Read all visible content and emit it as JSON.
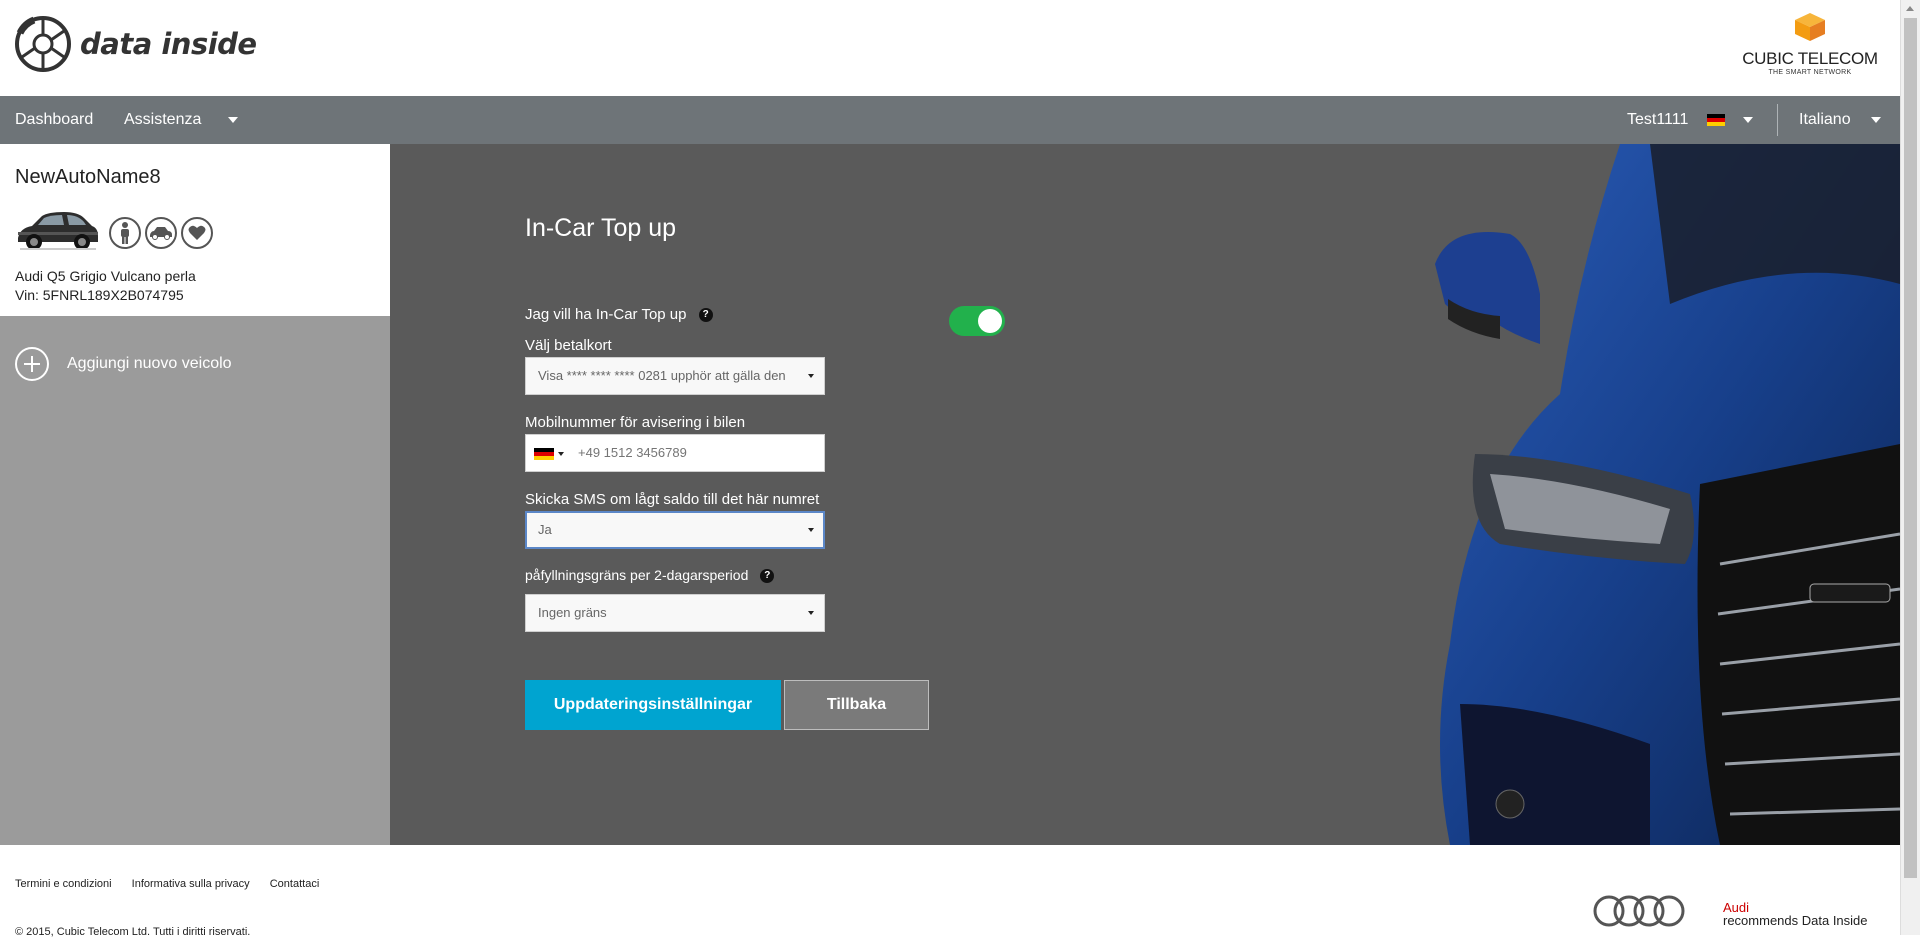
{
  "brand": {
    "logo_text": "data inside"
  },
  "partner": {
    "name": "CUBIC TELECOM",
    "tagline": "THE SMART NETWORK"
  },
  "nav": {
    "dashboard": "Dashboard",
    "assistance": "Assistenza",
    "user": "Test1111",
    "language": "Italiano"
  },
  "vehicle": {
    "name": "NewAutoName8",
    "model": "Audi Q5 Grigio Vulcano perla",
    "vin": "Vin: 5FNRL189X2B074795"
  },
  "sidebar": {
    "add_vehicle": "Aggiungi nuovo veicolo"
  },
  "form": {
    "title": "In-Car Top up",
    "enable_label": "Jag vill ha In-Car Top up",
    "enable_value": true,
    "card_label": "Välj betalkort",
    "card_value": "Visa **** **** **** 0281 upphör att gälla den",
    "mobile_label": "Mobilnummer för avisering i bilen",
    "mobile_placeholder": "+49 1512 3456789",
    "sms_label": "Skicka SMS om lågt saldo till det här numret",
    "sms_value": "Ja",
    "limit_label": "påfyllningsgräns per 2-dagarsperiod",
    "limit_value": "Ingen gräns",
    "help_glyph": "?",
    "update_button": "Uppdateringsinställningar",
    "back_button": "Tillbaka"
  },
  "footer": {
    "terms": "Termini e condizioni",
    "privacy": "Informativa sulla privacy",
    "contact": "Contattaci",
    "copyright": "© 2015, Cubic Telecom Ltd. Tutti i diritti riservati.",
    "audi_brand": "Audi",
    "audi_tagline": "recommends Data Inside"
  },
  "colors": {
    "nav_bg": "#6e7478",
    "main_bg": "#5a5a5a",
    "sidebar_bg": "#9b9b9b",
    "primary_button": "#00a4d0",
    "toggle_on": "#22b14c",
    "audi_red": "#cc0000"
  },
  "icons": [
    "wheel-logo-icon",
    "cube-logo-icon",
    "caret-down-icon",
    "germany-flag-icon",
    "person-icon",
    "car-icon",
    "heart-icon",
    "plus-circle-icon",
    "help-icon",
    "audi-rings-icon"
  ]
}
